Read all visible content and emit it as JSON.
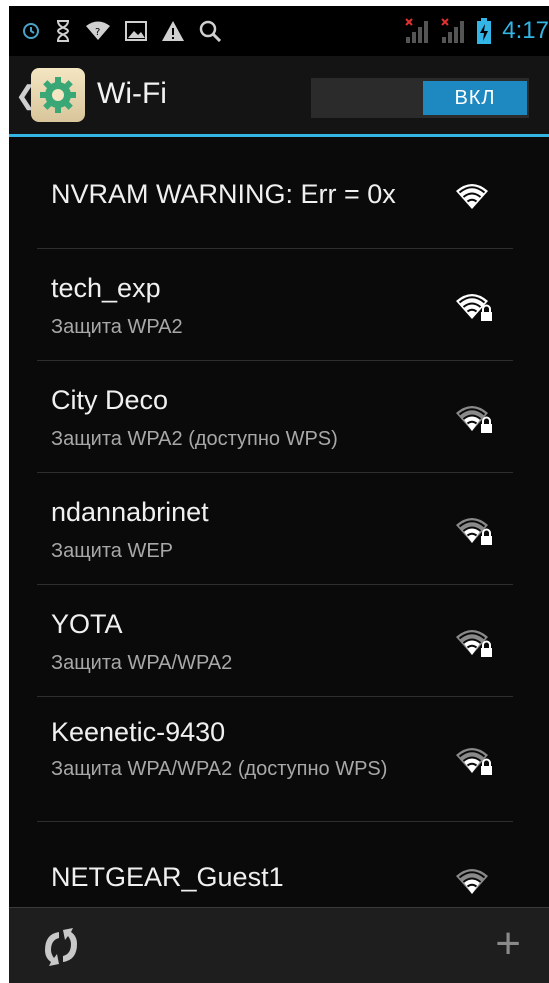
{
  "status_bar": {
    "time": "4:17",
    "icons": [
      "alarm-icon",
      "hourglass-icon",
      "wifi-notify-icon",
      "image-icon",
      "warning-icon",
      "search-icon"
    ],
    "right_icons": [
      "no-signal-sim1-icon",
      "no-signal-sim2-icon",
      "battery-charging-icon"
    ]
  },
  "action_bar": {
    "title": "Wi-Fi",
    "toggle_label": "ВКЛ",
    "icon": "settings-gear-icon"
  },
  "networks": [
    {
      "name": "NVRAM WARNING: Err = 0x",
      "security": "",
      "signal": 4,
      "locked": false
    },
    {
      "name": "tech_exp",
      "security": "Защита WPA2",
      "signal": 4,
      "locked": true
    },
    {
      "name": "City Deco",
      "security": "Защита WPA2 (доступно WPS)",
      "signal": 3,
      "locked": true
    },
    {
      "name": "ndannabrinet",
      "security": "Защита WEP",
      "signal": 3,
      "locked": true
    },
    {
      "name": "YOTA",
      "security": "Защита WPA/WPA2",
      "signal": 3,
      "locked": true
    },
    {
      "name": "Keenetic-9430",
      "security": "Защита WPA/WPA2 (доступно WPS)",
      "signal": 3,
      "locked": true
    },
    {
      "name": "NETGEAR_Guest1",
      "security": "",
      "signal": 3,
      "locked": false
    }
  ],
  "bottom_bar": {
    "left": "refresh-icon",
    "right": "add-network-icon",
    "plus_label": "+"
  },
  "colors": {
    "accent": "#33b5e5",
    "toggle_on": "#1e88c0",
    "background": "#0a0a0a"
  }
}
